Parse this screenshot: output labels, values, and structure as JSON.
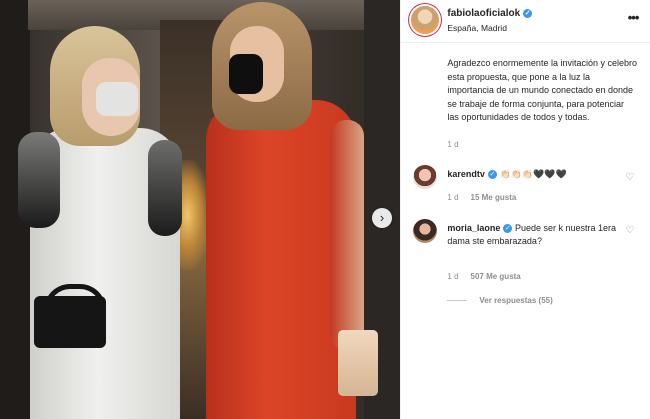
{
  "post": {
    "username": "fabiolaoficialok",
    "location": "España, Madrid",
    "caption": "Agradezco enormemente la invitación y celebro esta propuesta, que pone a la luz la importancia de un mundo conectado en donde se trabaje de forma conjunta, para potenciar las oportunidades de todos y todas.",
    "time": "1 d",
    "more_label": "•••",
    "next_label": "›"
  },
  "comments": [
    {
      "username": "karendtv",
      "text": "👏🏻👏🏻👏🏻🖤🖤🖤",
      "time": "1 d",
      "likes": "15 Me gusta"
    },
    {
      "username": "moria_laone",
      "text": "Puede ser k nuestra 1era dama ste embarazada?",
      "time": "1 d",
      "likes": "507 Me gusta",
      "replies": "Ver respuestas (55)"
    }
  ],
  "icons": {
    "verified": "verified-badge-icon",
    "heart": "heart-outline-icon",
    "next": "chevron-right-icon",
    "more": "more-options-icon"
  },
  "colors": {
    "verified_blue": "#3897f0",
    "secondary_text": "#8e8e8e",
    "primary_text": "#262626"
  }
}
